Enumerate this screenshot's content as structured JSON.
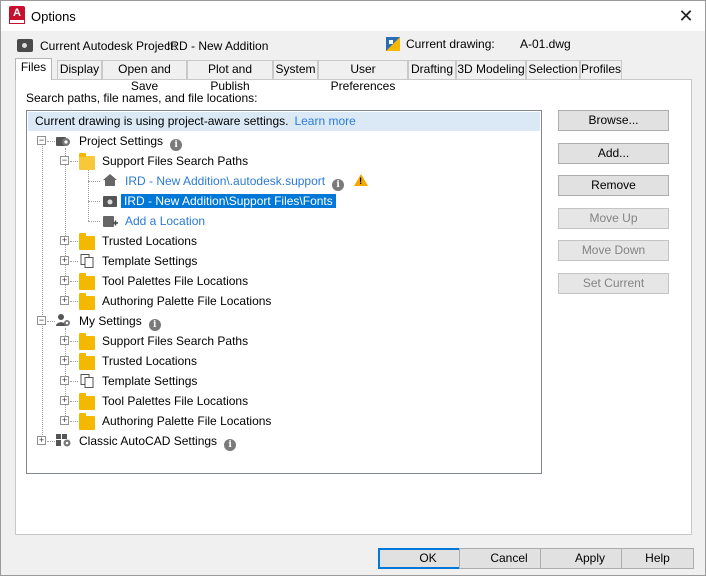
{
  "window": {
    "title": "Options",
    "app_icon_letter": "A"
  },
  "header": {
    "project_label": "Current Autodesk Project:",
    "project_name": "IRD - New Addition",
    "drawing_label": "Current drawing:",
    "drawing_name": "A-01.dwg"
  },
  "tabs": [
    {
      "label": "Files",
      "active": true
    },
    {
      "label": "Display"
    },
    {
      "label": "Open and Save"
    },
    {
      "label": "Plot and Publish"
    },
    {
      "label": "System"
    },
    {
      "label": "User Preferences"
    },
    {
      "label": "Drafting"
    },
    {
      "label": "3D Modeling"
    },
    {
      "label": "Selection"
    },
    {
      "label": "Profiles"
    }
  ],
  "files": {
    "section_label": "Search paths, file names, and file locations:",
    "banner_text": "Current drawing is using project-aware settings.",
    "banner_link": "Learn more",
    "tree": {
      "project_settings": "Project Settings",
      "support_paths": "Support Files Search Paths",
      "path1": "IRD - New Addition\\.autodesk.support",
      "path2": "IRD - New Addition\\Support Files\\Fonts",
      "add_location": "Add a Location",
      "trusted": "Trusted Locations",
      "template": "Template Settings",
      "tool_palettes": "Tool Palettes File Locations",
      "authoring": "Authoring Palette File Locations",
      "my_settings": "My Settings",
      "my_support": "Support Files Search Paths",
      "my_trusted": "Trusted Locations",
      "my_template": "Template Settings",
      "my_tool_palettes": "Tool Palettes File Locations",
      "my_authoring": "Authoring Palette File Locations",
      "classic": "Classic AutoCAD Settings"
    },
    "buttons": {
      "browse": "Browse...",
      "add": "Add...",
      "remove": "Remove",
      "move_up": "Move Up",
      "move_down": "Move Down",
      "set_current": "Set Current"
    }
  },
  "footer": {
    "ok": "OK",
    "cancel": "Cancel",
    "apply": "Apply",
    "help": "Help"
  },
  "colors": {
    "accent": "#0078d7",
    "link": "#2b7bd6",
    "folder": "#f5b800",
    "warning": "#f5a800",
    "banner": "#dbe9f6"
  }
}
